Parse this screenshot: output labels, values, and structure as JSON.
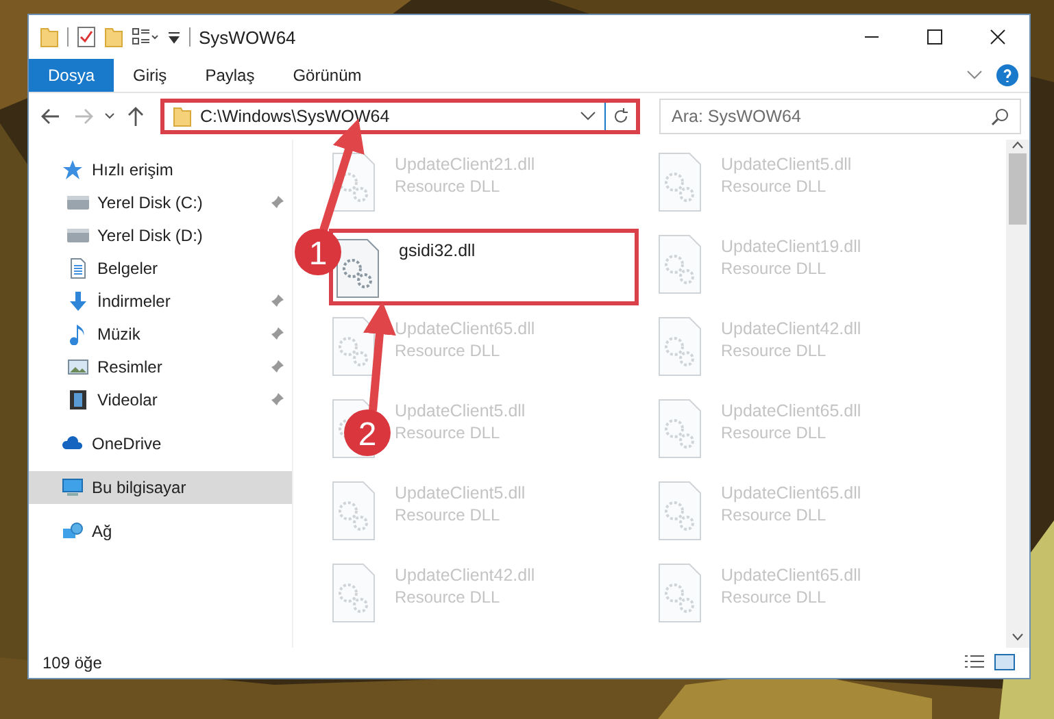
{
  "window": {
    "title": "SysWOW64"
  },
  "ribbon_tabs": [
    {
      "label": "Dosya",
      "selected": true
    },
    {
      "label": "Giriş",
      "selected": false
    },
    {
      "label": "Paylaş",
      "selected": false
    },
    {
      "label": "Görünüm",
      "selected": false
    }
  ],
  "address_bar": {
    "path": "C:\\Windows\\SysWOW64",
    "highlighted": true
  },
  "search": {
    "placeholder": "Ara: SysWOW64"
  },
  "sidebar": {
    "items": [
      {
        "label": "Hızlı erişim",
        "kind": "star",
        "selected": false,
        "children": [
          {
            "label": "Yerel Disk (C:)",
            "kind": "drive",
            "pinned": true,
            "selected": false
          },
          {
            "label": "Yerel Disk (D:)",
            "kind": "drive",
            "pinned": false,
            "selected": false
          },
          {
            "label": "Belgeler",
            "kind": "document",
            "pinned": false,
            "selected": false
          },
          {
            "label": "İndirmeler",
            "kind": "download",
            "pinned": true,
            "selected": false
          },
          {
            "label": "Müzik",
            "kind": "music",
            "pinned": true,
            "selected": false
          },
          {
            "label": "Resimler",
            "kind": "pictures",
            "pinned": true,
            "selected": false
          },
          {
            "label": "Videolar",
            "kind": "video",
            "pinned": true,
            "selected": false
          }
        ]
      },
      {
        "label": "OneDrive",
        "kind": "cloud",
        "selected": false
      },
      {
        "label": "Bu bilgisayar",
        "kind": "computer",
        "selected": true
      },
      {
        "label": "Ağ",
        "kind": "network",
        "selected": false
      }
    ]
  },
  "files": [
    {
      "name": "UpdateClient21.dll",
      "type": "Resource DLL",
      "faded": true,
      "highlighted": false
    },
    {
      "name": "UpdateClient5.dll",
      "type": "Resource DLL",
      "faded": true,
      "highlighted": false
    },
    {
      "name": "gsidi32.dll",
      "faded": false,
      "highlighted": true
    },
    {
      "name": "UpdateClient19.dll",
      "type": "Resource DLL",
      "faded": true,
      "highlighted": false
    },
    {
      "name": "UpdateClient65.dll",
      "type": "Resource DLL",
      "faded": true,
      "highlighted": false
    },
    {
      "name": "UpdateClient42.dll",
      "type": "Resource DLL",
      "faded": true,
      "highlighted": false
    },
    {
      "name": "UpdateClient5.dll",
      "type": "Resource DLL",
      "faded": true,
      "highlighted": false
    },
    {
      "name": "UpdateClient65.dll",
      "type": "Resource DLL",
      "faded": true,
      "highlighted": false
    },
    {
      "name": "UpdateClient5.dll",
      "type": "Resource DLL",
      "faded": true,
      "highlighted": false
    },
    {
      "name": "UpdateClient65.dll",
      "type": "Resource DLL",
      "faded": true,
      "highlighted": false
    },
    {
      "name": "UpdateClient42.dll",
      "type": "Resource DLL",
      "faded": true,
      "highlighted": false
    },
    {
      "name": "UpdateClient65.dll",
      "type": "Resource DLL",
      "faded": true,
      "highlighted": false
    }
  ],
  "status_bar": {
    "item_count": "109 öğe"
  },
  "callouts": [
    "1",
    "2"
  ]
}
